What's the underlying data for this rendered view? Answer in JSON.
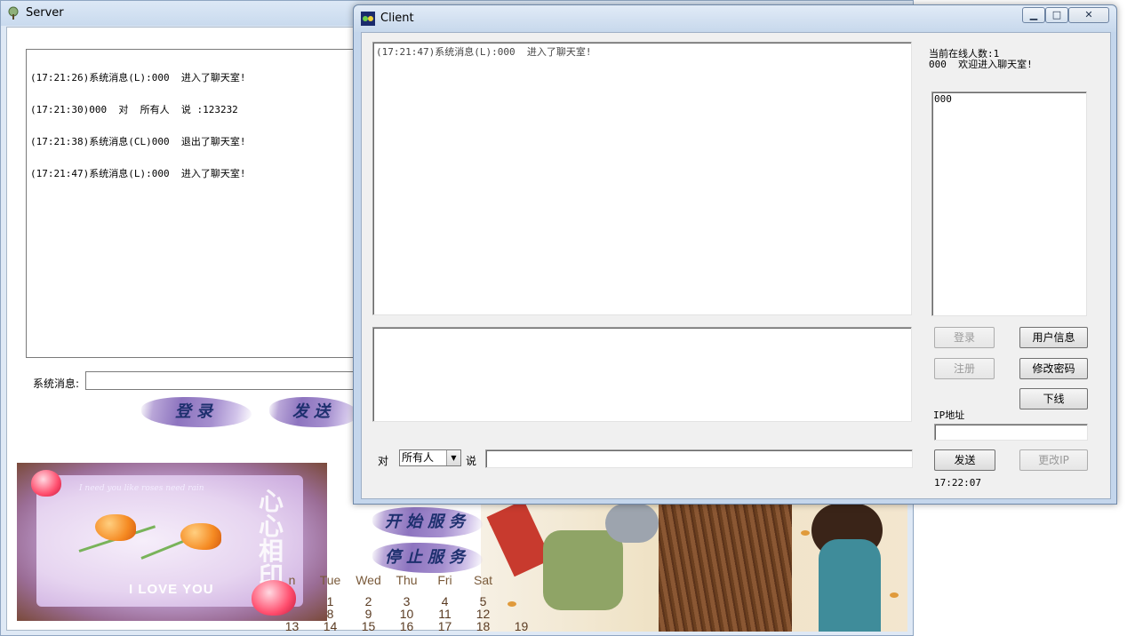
{
  "server": {
    "title": "Server",
    "log_lines": [
      "(17:21:26)系统消息(L):000  进入了聊天室!",
      "(17:21:30)000  对  所有人  说 :123232",
      "(17:21:38)系统消息(CL)000  退出了聊天室!",
      "(17:21:47)系统消息(L):000  进入了聊天室!"
    ],
    "system_message_label": "系统消息:",
    "system_message_value": "",
    "login_button": "登录",
    "send_button": "发送",
    "start_service_button": "开始服务",
    "stop_service_button": "停止服务",
    "love_card": {
      "caption": "I need you like roses need rain",
      "headline": "I LOVE YOU",
      "seal_text": "心心相印"
    },
    "calendar": {
      "headers": [
        "n",
        "Tue",
        "Wed",
        "Thu",
        "Fri",
        "Sat"
      ],
      "rows": [
        [
          "",
          "1",
          "2",
          "3",
          "4",
          "5"
        ],
        [
          "",
          "8",
          "9",
          "10",
          "11",
          "12"
        ],
        [
          "13",
          "14",
          "15",
          "16",
          "17",
          "18",
          "19"
        ]
      ]
    }
  },
  "client": {
    "title": "Client",
    "caption_buttons": {
      "minimize": "▁",
      "maximize": "□",
      "close": "✕"
    },
    "chat_log": "(17:21:47)系统消息(L):000  进入了聊天室!",
    "online_count": "当前在线人数:1",
    "welcome": "000  欢迎进入聊天室!",
    "users": [
      "000"
    ],
    "buttons": {
      "login": "登录",
      "user_info": "用户信息",
      "register": "注册",
      "change_password": "修改密码",
      "logout": "下线",
      "send": "发送",
      "change_ip": "更改IP"
    },
    "ip_label": "IP地址",
    "ip_value": "",
    "to_label": "对",
    "recipient": "所有人",
    "say_label": "说",
    "message_value": "",
    "clock": "17:22:07"
  }
}
